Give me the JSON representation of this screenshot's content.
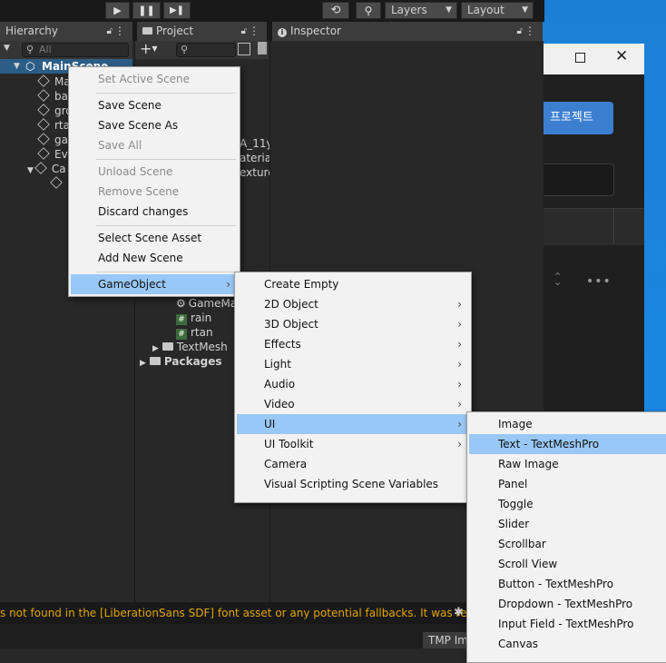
{
  "toolbar": {
    "layers_label": "Layers",
    "layout_label": "Layout"
  },
  "hierarchy": {
    "tab_label": "Hierarchy",
    "search_placeholder": "All",
    "scene_name": "MainScene",
    "items": [
      "Ma",
      "ba",
      "gro",
      "rta",
      "ga",
      "Eve",
      "Ca"
    ]
  },
  "project": {
    "tab_label": "Project",
    "partial_items": [
      "A_11y",
      "ateria",
      "exture"
    ],
    "items": [
      "GameMa",
      "rain",
      "rtan",
      "TextMesh",
      "Packages"
    ]
  },
  "inspector": {
    "tab_label": "Inspector"
  },
  "external_window": {
    "button_label": "프로젝트"
  },
  "context_menu": {
    "items": [
      {
        "label": "Set Active Scene",
        "enabled": false
      },
      {
        "label": "Save Scene",
        "enabled": true
      },
      {
        "label": "Save Scene As",
        "enabled": true
      },
      {
        "label": "Save All",
        "enabled": false
      },
      {
        "label": "Unload Scene",
        "enabled": false
      },
      {
        "label": "Remove Scene",
        "enabled": false
      },
      {
        "label": "Discard changes",
        "enabled": true
      },
      {
        "label": "Select Scene Asset",
        "enabled": true
      },
      {
        "label": "Add New Scene",
        "enabled": true
      },
      {
        "label": "GameObject",
        "enabled": true
      }
    ]
  },
  "gameobject_menu": {
    "items": [
      "Create Empty",
      "2D Object",
      "3D Object",
      "Effects",
      "Light",
      "Audio",
      "Video",
      "UI",
      "UI Toolkit",
      "Camera",
      "Visual Scripting Scene Variables"
    ]
  },
  "ui_menu": {
    "items": [
      "Image",
      "Text - TextMeshPro",
      "Raw Image",
      "Panel",
      "Toggle",
      "Slider",
      "Scrollbar",
      "Scroll View",
      "Button - TextMeshPro",
      "Dropdown - TextMeshPro",
      "Input Field - TextMeshPro",
      "Canvas"
    ]
  },
  "console": {
    "message": "s not found in the [LiberationSans SDF] font asset or any potential fallbacks. It was re"
  },
  "bottom": {
    "tmp_button_label": "TMP Im"
  },
  "colors": {
    "highlight": "#99c8f7",
    "warning_text": "#e0a500",
    "scene_blue": "#4c94f0",
    "windows_accent": "#3c7fd0"
  }
}
